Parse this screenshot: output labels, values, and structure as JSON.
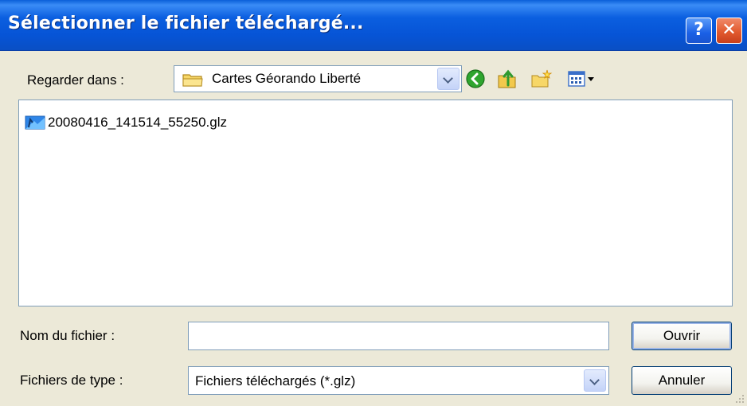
{
  "window": {
    "title": "Sélectionner le fichier téléchargé...",
    "help_label": "?",
    "close_label": "✕"
  },
  "look_in": {
    "label": "Regarder dans :",
    "value": "Cartes Géorando Liberté"
  },
  "toolbar": {
    "icons": [
      "back-icon",
      "up-folder-icon",
      "new-folder-icon",
      "view-menu-icon"
    ]
  },
  "files": [
    {
      "name": "20080416_141514_55250.glz",
      "icon": "glz-file-icon"
    }
  ],
  "file_name": {
    "label": "Nom du fichier :",
    "value": "",
    "placeholder": ""
  },
  "file_type": {
    "label": "Fichiers de type :",
    "value": "Fichiers téléchargés (*.glz)"
  },
  "buttons": {
    "open": "Ouvrir",
    "cancel": "Annuler"
  },
  "colors": {
    "titlebar": "#0654d6",
    "face": "#ece9d8",
    "border": "#7f9db9"
  }
}
